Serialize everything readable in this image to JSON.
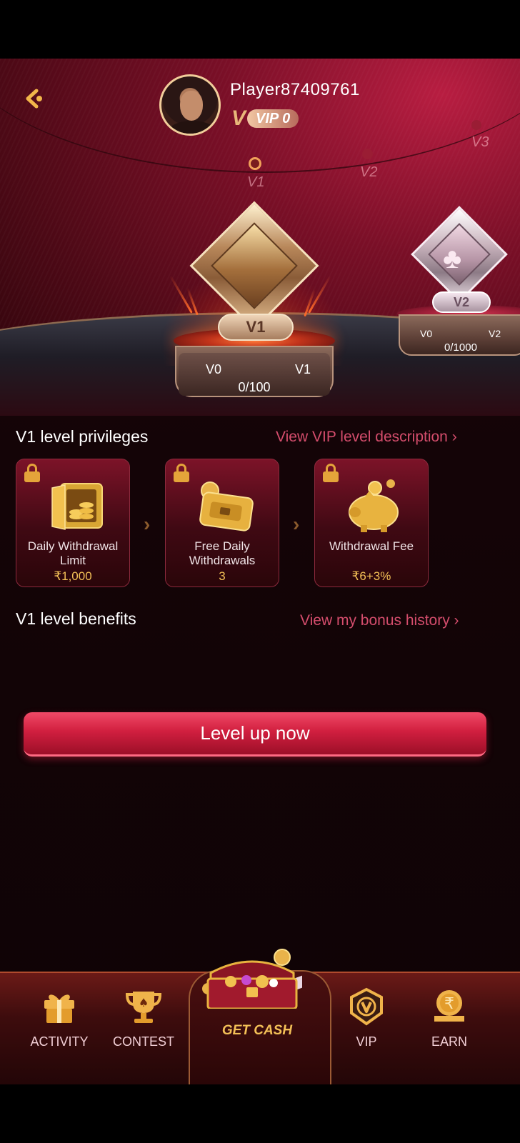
{
  "player": {
    "name": "Player87409761",
    "vip_prefix": "V",
    "vip_label": "VIP 0"
  },
  "level_track": {
    "labels": [
      "V1",
      "V2",
      "V3"
    ]
  },
  "current_level": {
    "badge": "V1",
    "from": "V0",
    "to": "V1",
    "progress": "0/100"
  },
  "next_level": {
    "badge": "V2",
    "from": "V0",
    "to": "V2",
    "progress": "0/1000"
  },
  "privileges": {
    "title": "V1 level privileges",
    "link": "View VIP level description ›",
    "cards": [
      {
        "title": "Daily Withdrawal Limit",
        "value": "₹1,000",
        "icon": "vault-icon"
      },
      {
        "title": "Free Daily Withdrawals",
        "value": "3",
        "icon": "wallet-icon"
      },
      {
        "title": "Withdrawal Fee",
        "value": "₹6+3%",
        "icon": "piggy-bank-icon"
      }
    ]
  },
  "benefits": {
    "title": "V1 level benefits",
    "link": "View my bonus history ›"
  },
  "level_up_button": "Level up now",
  "nav": {
    "activity": "ACTIVITY",
    "contest": "CONTEST",
    "get_cash": "GET CASH",
    "vip": "VIP",
    "earn": "EARN"
  },
  "colors": {
    "accent": "#d11f3f",
    "gold": "#f3c057",
    "link": "#d44d6c"
  }
}
